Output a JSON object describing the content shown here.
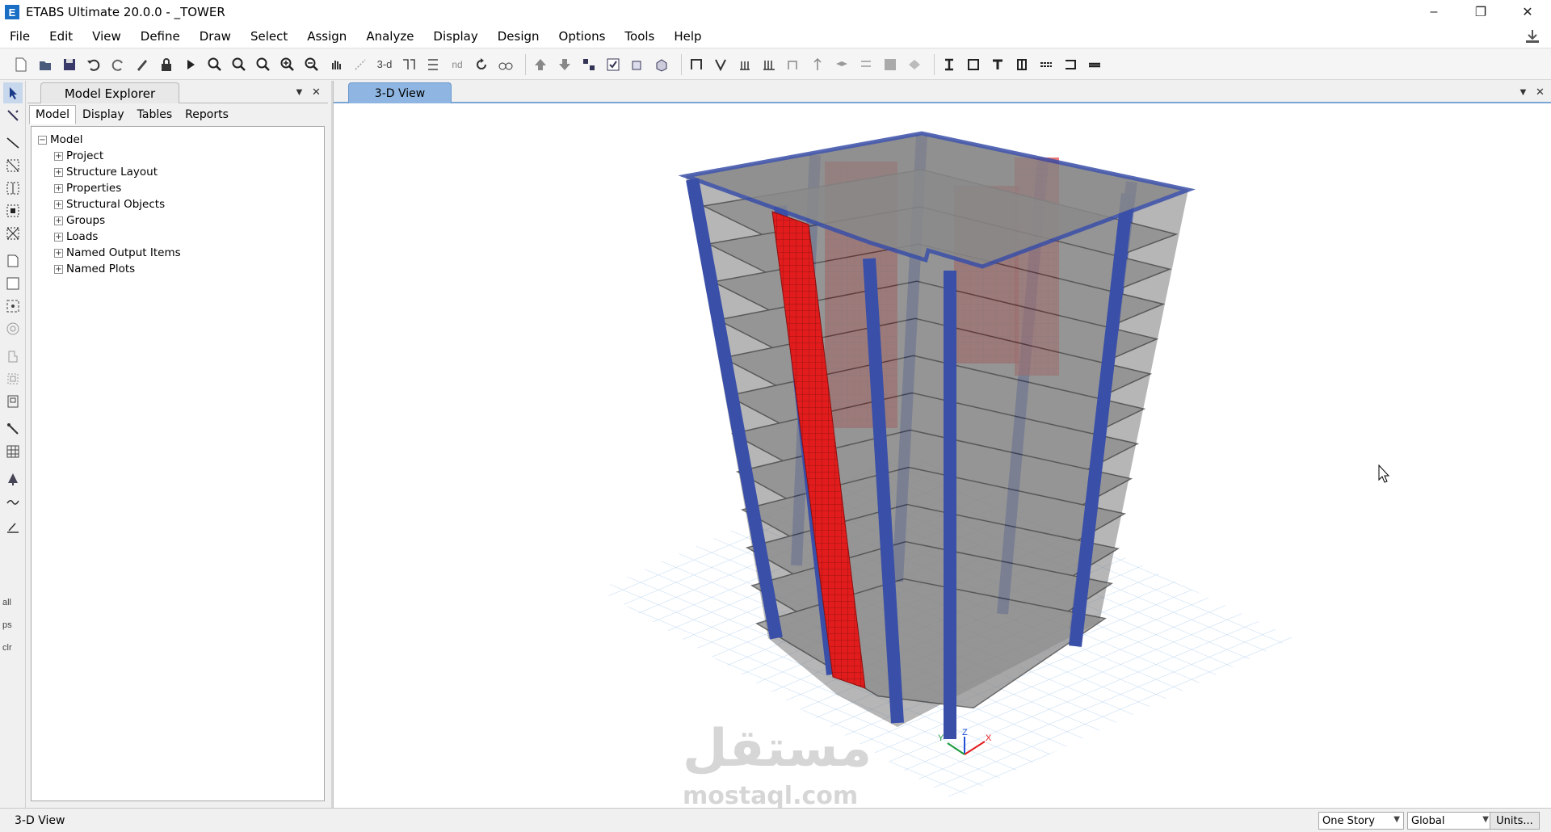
{
  "app": {
    "title": "ETABS Ultimate 20.0.0 - _TOWER",
    "icon_letter": "E"
  },
  "window_controls": {
    "minimize": "–",
    "restore": "❐",
    "close": "✕"
  },
  "menu": [
    "File",
    "Edit",
    "View",
    "Define",
    "Draw",
    "Select",
    "Assign",
    "Analyze",
    "Display",
    "Design",
    "Options",
    "Tools",
    "Help"
  ],
  "toolbar": {
    "label_3d": "3-d",
    "label_nd": "nd"
  },
  "left_tools": {
    "all": "all",
    "ps": "ps",
    "clr": "clr"
  },
  "explorer": {
    "title": "Model Explorer",
    "tabs": [
      "Model",
      "Display",
      "Tables",
      "Reports"
    ],
    "active_tab": "Model",
    "root": "Model",
    "items": [
      "Project",
      "Structure Layout",
      "Properties",
      "Structural Objects",
      "Groups",
      "Loads",
      "Named Output Items",
      "Named Plots"
    ]
  },
  "view": {
    "tab_title": "3-D View"
  },
  "axes": {
    "x": "X",
    "y": "Y",
    "z": "Z"
  },
  "status": {
    "text": "3-D View",
    "story_option": "One Story",
    "coord_system": "Global",
    "units_button": "Units..."
  },
  "watermark": {
    "arabic": "مستقل",
    "latin": "mostaql.com"
  },
  "colors": {
    "accent_tab": "#8fb6e2",
    "columns": "#3a4fa8",
    "shear_wall": "#e01b1b",
    "slab": "#6e6e6e",
    "grid": "#9fc3ea"
  }
}
